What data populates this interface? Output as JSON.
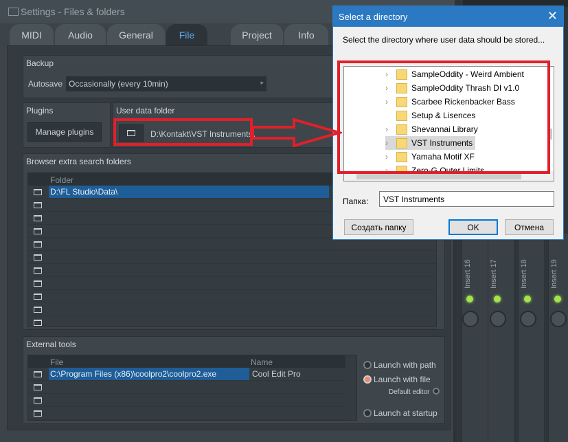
{
  "settings": {
    "title": "Settings - Files & folders",
    "tabs": [
      {
        "label": "MIDI"
      },
      {
        "label": "Audio"
      },
      {
        "label": "General"
      },
      {
        "label": "File",
        "active": true
      },
      {
        "label": "Project"
      },
      {
        "label": "Info"
      }
    ],
    "backup": {
      "title": "Backup",
      "autosave_label": "Autosave",
      "autosave_value": "Occasionally (every 10min)"
    },
    "plugins": {
      "title": "Plugins",
      "manage_label": "Manage plugins"
    },
    "user_data": {
      "title": "User data folder",
      "path": "D:\\Kontakt\\VST Instruments\\"
    },
    "browser": {
      "title": "Browser extra search folders",
      "column": "Folder",
      "rows": [
        "D:\\FL Studio\\Data\\",
        "",
        "",
        "",
        "",
        "",
        "",
        "",
        "",
        "",
        ""
      ]
    },
    "external": {
      "title": "External tools",
      "columns": [
        "File",
        "Name"
      ],
      "rows": [
        {
          "file": "C:\\Program Files (x86)\\coolpro2\\coolpro2.exe",
          "name": "Cool Edit Pro"
        },
        {
          "file": "",
          "name": ""
        },
        {
          "file": "",
          "name": ""
        },
        {
          "file": "",
          "name": ""
        }
      ],
      "launch_with_path": "Launch with path",
      "launch_with_file": "Launch with file",
      "default_editor": "Default editor",
      "launch_at_startup": "Launch at startup"
    }
  },
  "dialog": {
    "title": "Select a directory",
    "prompt": "Select the directory where user data should be stored...",
    "tree": [
      {
        "label": "SampleOddity - Weird Ambient",
        "expandable": true
      },
      {
        "label": "SampleOddity Thrash DI v1.0",
        "expandable": true
      },
      {
        "label": "Scarbee Rickenbacker Bass",
        "expandable": true
      },
      {
        "label": "Setup & Lisences",
        "expandable": false
      },
      {
        "label": "Shevannai Library",
        "expandable": true
      },
      {
        "label": "VST Instruments",
        "expandable": true,
        "selected": true
      },
      {
        "label": "Yamaha Motif XF",
        "expandable": true
      },
      {
        "label": "Zero-G Outer Limits",
        "expandable": true
      }
    ],
    "folder_label": "Папка:",
    "folder_value": "VST Instruments",
    "new_folder": "Создать папку",
    "ok": "OK",
    "cancel": "Отмена"
  },
  "mixer": {
    "inserts": [
      "Insert 16",
      "Insert 17",
      "Insert 18",
      "Insert 19"
    ]
  },
  "colors": {
    "accent": "#5ea8e8",
    "selection": "#1f5d97",
    "annotation": "#e0202a",
    "dialog_title": "#2b79c2"
  }
}
